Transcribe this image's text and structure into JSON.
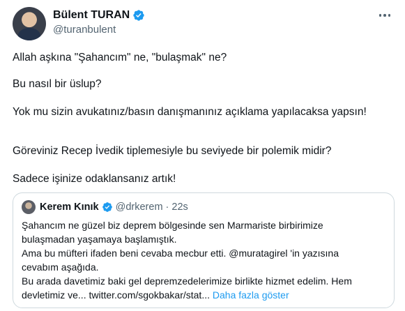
{
  "author": {
    "name": "Bülent TURAN",
    "handle": "@turanbulent",
    "verified_color": "#1d9bf0"
  },
  "tweet": {
    "paragraphs": [
      "Allah aşkına \"Şahancım\" ne, \"bulaşmak\" ne?",
      "Bu nasıl bir üslup?",
      "Yok mu sizin avukatınız/basın danışmanınız açıklama yapılacaksa yapsın!",
      "Göreviniz Recep İvedik tiplemesiyle bu seviyede bir polemik midir?",
      "Sadece işinize odaklansanız artık!"
    ]
  },
  "quote": {
    "name": "Kerem Kınık",
    "handle": "@drkerem",
    "separator": "·",
    "time": "22s",
    "lines": [
      "Şahancım ne güzel biz deprem bölgesinde sen Marmariste birbirimize",
      "bulaşmadan yaşamaya başlamıştık.",
      "Ama bu müfteri ifaden beni cevaba mecbur etti. @muratagirel 'in yazısına",
      "cevabım aşağıda.",
      "Bu arada davetimiz baki gel depremzedelerimize birlikte hizmet edelim. Hem"
    ],
    "last_line": "devletimiz ve... twitter.com/sgokbakar/stat...",
    "show_more": "Daha fazla göster"
  },
  "icons": {
    "avatar": "user-avatar",
    "verified": "verified-badge-icon",
    "more": "more-options-icon"
  }
}
